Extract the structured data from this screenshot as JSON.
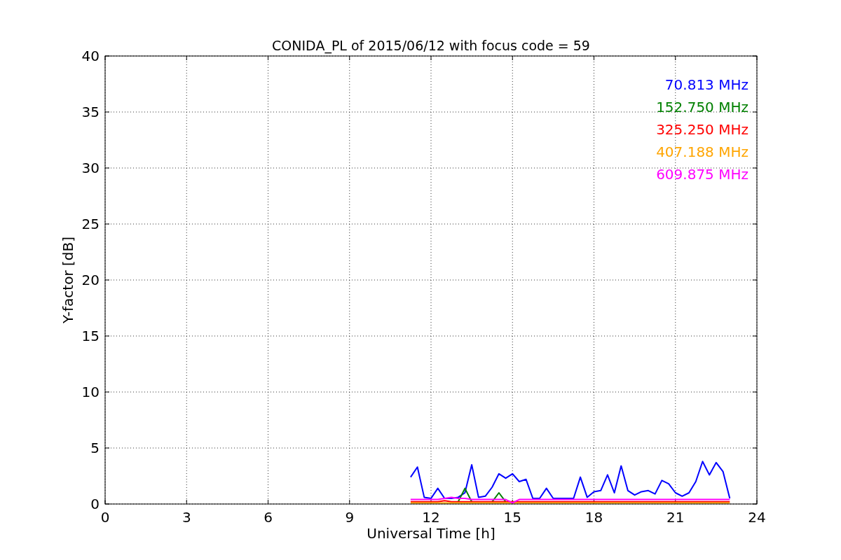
{
  "chart_data": {
    "type": "line",
    "title": "CONIDA_PL of 2015/06/12 with focus code = 59",
    "xlabel": "Universal Time [h]",
    "ylabel": "Y-factor [dB]",
    "xlim": [
      0,
      24
    ],
    "ylim": [
      0,
      40
    ],
    "xticks": [
      0,
      3,
      6,
      9,
      12,
      15,
      18,
      21,
      24
    ],
    "yticks": [
      0,
      5,
      10,
      15,
      20,
      25,
      30,
      35,
      40
    ],
    "grid": true,
    "x": [
      11.25,
      11.5,
      11.75,
      12,
      12.25,
      12.5,
      12.75,
      13,
      13.25,
      13.5,
      13.75,
      14,
      14.25,
      14.5,
      14.75,
      15,
      15.25,
      15.5,
      15.75,
      16,
      16.25,
      16.5,
      16.75,
      17,
      17.25,
      17.5,
      17.75,
      18,
      18.25,
      18.5,
      18.75,
      19,
      19.25,
      19.5,
      19.75,
      20,
      20.25,
      20.5,
      20.75,
      21,
      21.25,
      21.5,
      21.75,
      22,
      22.25,
      22.5,
      22.75,
      23
    ],
    "series": [
      {
        "name": "70.813 MHz",
        "color": "#0000ff",
        "values": [
          2.4,
          3.3,
          0.6,
          0.5,
          1.4,
          0.5,
          0.5,
          0.6,
          1.0,
          3.5,
          0.6,
          0.7,
          1.5,
          2.7,
          2.3,
          2.7,
          2.0,
          2.2,
          0.5,
          0.5,
          1.4,
          0.5,
          0.5,
          0.5,
          0.5,
          2.4,
          0.6,
          1.1,
          1.2,
          2.6,
          1.0,
          3.4,
          1.2,
          0.8,
          1.1,
          1.2,
          0.9,
          2.1,
          1.8,
          1.0,
          0.7,
          1.0,
          2.0,
          3.8,
          2.6,
          3.7,
          2.9,
          0.5
        ]
      },
      {
        "name": "152.750 MHz",
        "color": "#008000",
        "values": [
          null,
          null,
          null,
          null,
          null,
          null,
          null,
          0.2,
          1.4,
          0.2,
          null,
          null,
          0.2,
          1.0,
          0.2,
          null,
          null,
          null,
          null,
          null,
          null,
          null,
          null,
          null,
          null,
          null,
          null,
          null,
          null,
          null,
          null,
          null,
          null,
          null,
          null,
          null,
          null,
          null,
          null,
          null,
          null,
          null,
          null,
          null,
          null,
          null,
          null,
          null
        ]
      },
      {
        "name": "325.250 MHz",
        "color": "#ff0000",
        "values": [
          0.2,
          0.2,
          0.2,
          0.2,
          0.2,
          0.3,
          0.2,
          0.2,
          0.2,
          0.2,
          0.2,
          0.2,
          0.2,
          0.2,
          0.2,
          0.2,
          0.2,
          0.2,
          0.2,
          0.2,
          0.2,
          0.2,
          0.2,
          0.2,
          0.2,
          0.2,
          0.2,
          0.2,
          0.2,
          0.2,
          0.2,
          0.2,
          0.2,
          0.2,
          0.2,
          0.2,
          0.2,
          0.2,
          0.2,
          0.2,
          0.2,
          0.2,
          0.2,
          0.2,
          0.2,
          0.2,
          0.2,
          0.2
        ]
      },
      {
        "name": "407.188 MHz",
        "color": "#ffa500",
        "values": [
          0.1,
          0.1,
          0.1,
          0.1,
          0.1,
          0.1,
          0.1,
          0.1,
          0.1,
          0.1,
          0.1,
          0.1,
          0.1,
          0.1,
          0.1,
          0.1,
          0.1,
          0.1,
          0.1,
          0.1,
          0.1,
          0.1,
          0.1,
          0.1,
          0.1,
          0.1,
          0.1,
          0.1,
          0.1,
          0.1,
          0.1,
          0.1,
          0.1,
          0.1,
          0.1,
          0.1,
          0.1,
          0.1,
          0.1,
          0.1,
          0.1,
          0.1,
          0.1,
          0.1,
          0.1,
          0.1,
          0.1,
          0.1
        ]
      },
      {
        "name": "609.875 MHz",
        "color": "#ff00ff",
        "values": [
          0.4,
          0.4,
          0.4,
          0.4,
          0.4,
          0.5,
          0.6,
          0.5,
          0.5,
          0.4,
          0.4,
          0.4,
          0.4,
          0.4,
          0.4,
          0.1,
          0.4,
          0.4,
          0.4,
          0.4,
          0.4,
          0.4,
          0.4,
          0.4,
          0.4,
          0.4,
          0.4,
          0.4,
          0.4,
          0.4,
          0.4,
          0.4,
          0.4,
          0.4,
          0.4,
          0.4,
          0.4,
          0.4,
          0.4,
          0.4,
          0.4,
          0.4,
          0.4,
          0.4,
          0.4,
          0.4,
          0.4,
          0.4
        ]
      }
    ]
  }
}
